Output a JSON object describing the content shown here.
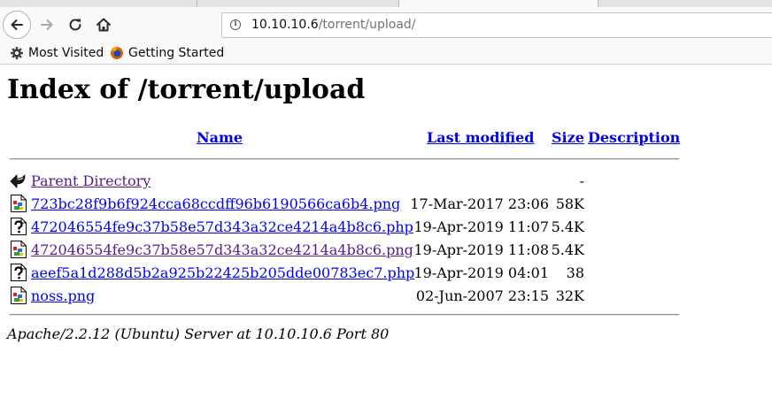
{
  "browser": {
    "url_host": "10.10.10.6",
    "url_path": "/torrent/upload/",
    "bookmarks": [
      {
        "label": "Most Visited",
        "icon": "gear-icon"
      },
      {
        "label": "Getting Started",
        "icon": "firefox-icon"
      }
    ]
  },
  "page": {
    "heading": "Index of /torrent/upload",
    "columns": {
      "name": "Name",
      "last_modified": "Last modified",
      "size": "Size",
      "description": "Description"
    },
    "parent": {
      "label": "Parent Directory",
      "size": "-",
      "icon": "back-arrow-icon"
    },
    "files": [
      {
        "name": "723bc28f9b6f924cca68ccdff96b6190566ca6b4.png",
        "modified": "17-Mar-2017 23:06",
        "size": "58K",
        "icon": "image-icon",
        "visited": false
      },
      {
        "name": "472046554fe9c37b58e57d343a32ce4214a4b8c6.php",
        "modified": "19-Apr-2019 11:07",
        "size": "5.4K",
        "icon": "unknown-file-icon",
        "visited": false
      },
      {
        "name": "472046554fe9c37b58e57d343a32ce4214a4b8c6.png",
        "modified": "19-Apr-2019 11:08",
        "size": "5.4K",
        "icon": "image-icon",
        "visited": true
      },
      {
        "name": "aeef5a1d288d5b2a925b22425b205dde00783ec7.php",
        "modified": "19-Apr-2019 04:01",
        "size": "38",
        "icon": "unknown-file-icon",
        "visited": false
      },
      {
        "name": "noss.png",
        "modified": "02-Jun-2007 23:15",
        "size": "32K",
        "icon": "image-icon",
        "visited": false
      }
    ],
    "server_signature": "Apache/2.2.12 (Ubuntu) Server at 10.10.10.6 Port 80"
  }
}
